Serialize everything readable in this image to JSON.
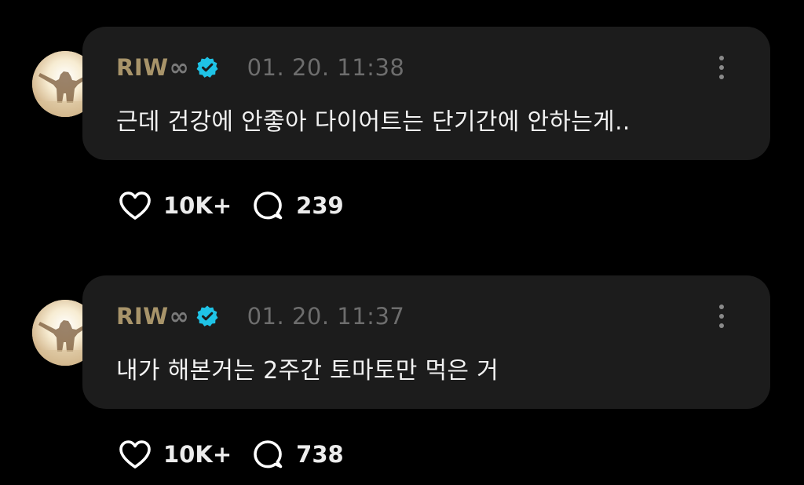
{
  "posts": [
    {
      "username": "RIW",
      "username_suffix": "∞",
      "verified_icon": "verified-badge-icon",
      "timestamp": "01. 20. 11:38",
      "content": "근데 건강에 안좋아 다이어트는 단기간에 안하는게..",
      "likes": "10K+",
      "comments": "239"
    },
    {
      "username": "RIW",
      "username_suffix": "∞",
      "verified_icon": "verified-badge-icon",
      "timestamp": "01. 20. 11:37",
      "content": "내가 해본거는 2주간 토마토만 먹은 거",
      "likes": "10K+",
      "comments": "738"
    }
  ],
  "colors": {
    "background": "#000000",
    "bubble": "#1c1c1c",
    "username": "#a8946a",
    "timestamp": "#6d6d6d",
    "verified": "#1fc3e6",
    "text": "#f2f2f2"
  }
}
